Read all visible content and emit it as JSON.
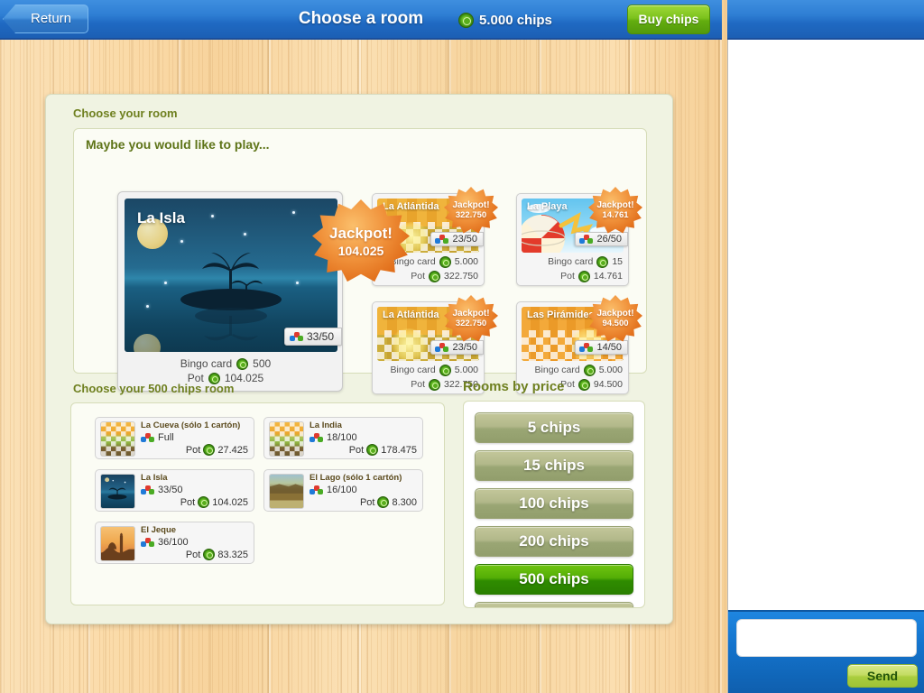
{
  "topbar": {
    "return_label": "Return",
    "title": "Choose a room",
    "chips_balance": "5.000 chips",
    "buy_chips_label": "Buy chips",
    "chip_icon": "chip-icon"
  },
  "main": {
    "section_title": "Choose your room",
    "featured_subtitle": "Maybe you would like to play...",
    "chips_room_title": "Choose your 500 chips room",
    "price_title": "Rooms by price"
  },
  "featured_room": {
    "name": "La Isla",
    "players": "33/50",
    "bingo_card_label": "Bingo card",
    "bingo_card_value": "500",
    "pot_label": "Pot",
    "pot_value": "104.025",
    "jackpot_label": "Jackpot!",
    "jackpot_value": "104.025",
    "art": "night-island"
  },
  "room_cards": [
    {
      "name": "La Atlántida",
      "players": "23/50",
      "bingo_card_label": "Bingo card",
      "bingo_card_value": "5.000",
      "pot_label": "Pot",
      "pot_value": "322.750",
      "jackpot_label": "Jackpot!",
      "jackpot_value": "322.750",
      "art": "mosaic-gold"
    },
    {
      "name": "La Playa",
      "players": "26/50",
      "bingo_card_label": "Bingo card",
      "bingo_card_value": "15",
      "pot_label": "Pot",
      "pot_value": "14.761",
      "jackpot_label": "Jackpot!",
      "jackpot_value": "14.761",
      "art": "beach"
    },
    {
      "name": "La Atlántida",
      "players": "23/50",
      "bingo_card_label": "Bingo card",
      "bingo_card_value": "5.000",
      "pot_label": "Pot",
      "pot_value": "322.750",
      "jackpot_label": "Jackpot!",
      "jackpot_value": "322.750",
      "art": "mosaic-gold"
    },
    {
      "name": "Las Pirámides",
      "players": "14/50",
      "bingo_card_label": "Bingo card",
      "bingo_card_value": "5.000",
      "pot_label": "Pot",
      "pot_value": "94.500",
      "jackpot_label": "Jackpot!",
      "jackpot_value": "94.500",
      "art": "mosaic-green"
    }
  ],
  "room_list": [
    {
      "name": "La Cueva (sólo 1 cartón)",
      "players": "Full",
      "pot_label": "Pot",
      "pot_value": "27.425",
      "art": "art-mosaic"
    },
    {
      "name": "La India",
      "players": "18/100",
      "pot_label": "Pot",
      "pot_value": "178.475",
      "art": "art-mosaic"
    },
    {
      "name": "La Isla",
      "players": "33/50",
      "pot_label": "Pot",
      "pot_value": "104.025",
      "art": "art-island"
    },
    {
      "name": "El Lago (sólo 1 cartón)",
      "players": "16/100",
      "pot_label": "Pot",
      "pot_value": "8.300",
      "art": "art-lake"
    },
    {
      "name": "El Jeque",
      "players": "36/100",
      "pot_label": "Pot",
      "pot_value": "83.325",
      "art": "art-jeque"
    }
  ],
  "price_buttons": [
    {
      "label": "5 chips",
      "active": false
    },
    {
      "label": "15 chips",
      "active": false
    },
    {
      "label": "100 chips",
      "active": false
    },
    {
      "label": "200 chips",
      "active": false
    },
    {
      "label": "500 chips",
      "active": true
    },
    {
      "label": "",
      "active": false
    }
  ],
  "chat": {
    "input_value": "",
    "input_placeholder": "",
    "send_label": "Send"
  },
  "colors": {
    "accent_blue": "#1f69c2",
    "accent_green": "#63ad0f",
    "panel_bg": "#f0f3e2",
    "heading_olive": "#6f8020",
    "jackpot_orange": "#e2701c",
    "active_green": "#2f8c00"
  }
}
